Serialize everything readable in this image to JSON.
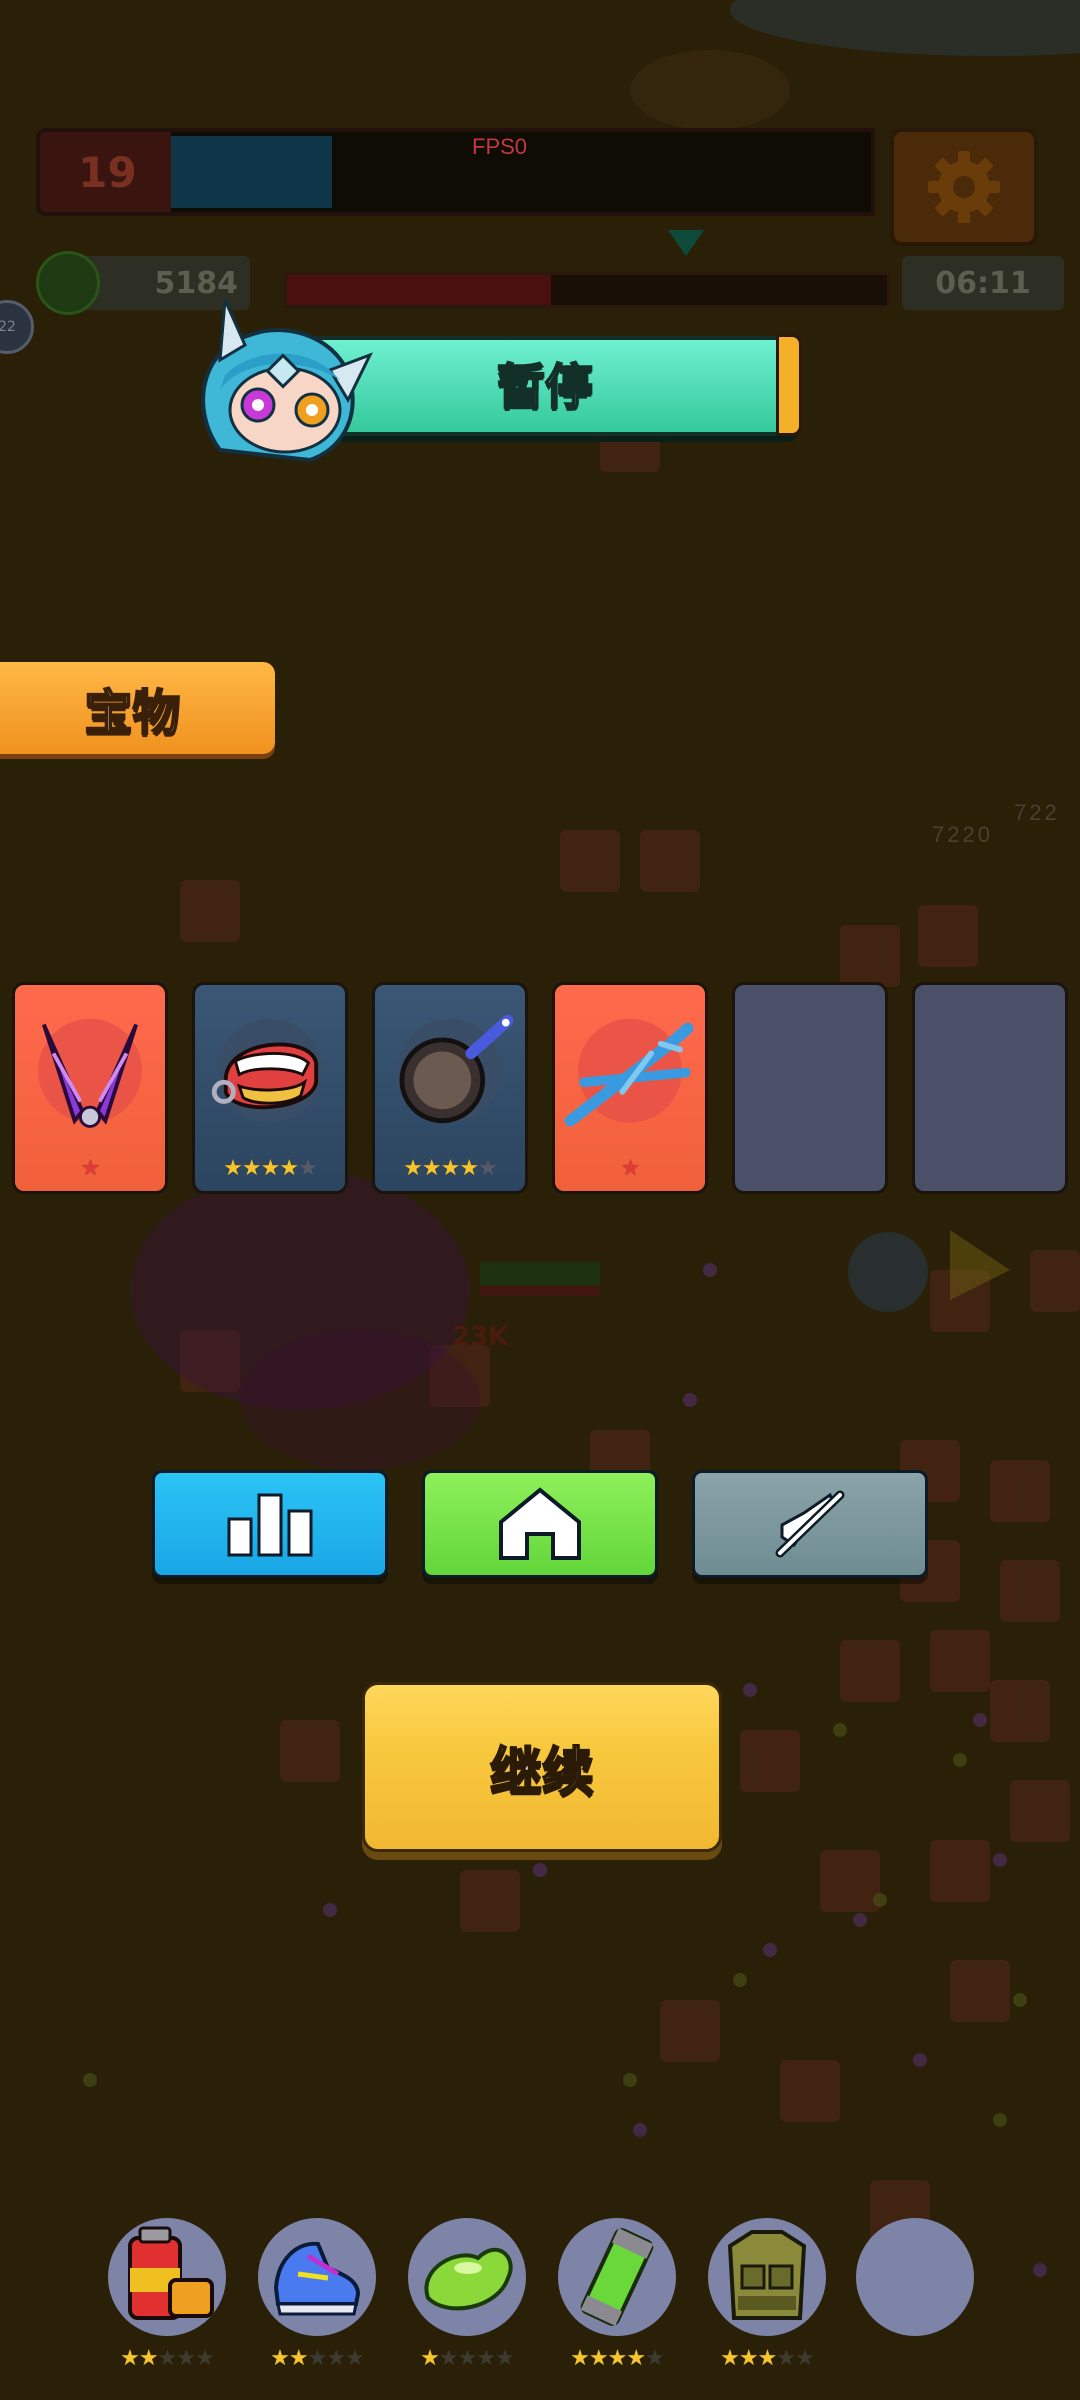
{
  "hud": {
    "level": "19",
    "xp_fraction": 0.23,
    "fps": "FPS0",
    "coins": "5184",
    "timer": "06:11",
    "boss_progress_fraction": 0.44,
    "left_orb_label": "22",
    "settings_icon": "gear-icon"
  },
  "pause": {
    "title": "暂停",
    "hero_icon": "hero-portrait-icon"
  },
  "treasure": {
    "title": "宝物",
    "cards": [
      {
        "icon": "purple-claw-icon",
        "color": "red",
        "stars": 1,
        "max_stars": 1
      },
      {
        "icon": "chattering-teeth-icon",
        "color": "blue",
        "stars": 4,
        "max_stars": 5
      },
      {
        "icon": "frying-pan-icon",
        "color": "blue",
        "stars": 4,
        "max_stars": 5
      },
      {
        "icon": "blue-branches-icon",
        "color": "red",
        "stars": 1,
        "max_stars": 1
      },
      {
        "icon": "",
        "color": "empty",
        "stars": 0,
        "max_stars": 0
      },
      {
        "icon": "",
        "color": "empty",
        "stars": 0,
        "max_stars": 0
      }
    ]
  },
  "buttons": {
    "stats_icon": "bar-chart-icon",
    "home_icon": "home-icon",
    "sound_icon": "muted-icon",
    "continue": "继续"
  },
  "background": {
    "damage_numbers": [
      "7220",
      "722"
    ],
    "floating_damage": "23K"
  },
  "equipment": [
    {
      "icon": "fuel-canister-icon",
      "stars": 2,
      "max_stars": 5
    },
    {
      "icon": "sneaker-icon",
      "stars": 2,
      "max_stars": 5
    },
    {
      "icon": "green-bean-icon",
      "stars": 1,
      "max_stars": 5
    },
    {
      "icon": "battery-capsule-icon",
      "stars": 4,
      "max_stars": 5
    },
    {
      "icon": "tactical-vest-icon",
      "stars": 3,
      "max_stars": 5
    },
    {
      "icon": "",
      "stars": 0,
      "max_stars": 0
    }
  ],
  "colors": {
    "background": "#2a2008",
    "card_red": "#f0603a",
    "card_blue": "#2c4560",
    "button_blue": "#1aa6e6",
    "button_green": "#62d63a",
    "button_gray": "#6e8c92",
    "continue_yellow": "#f7c83d",
    "banner_teal": "#35c99c",
    "tab_orange": "#f0911f"
  }
}
